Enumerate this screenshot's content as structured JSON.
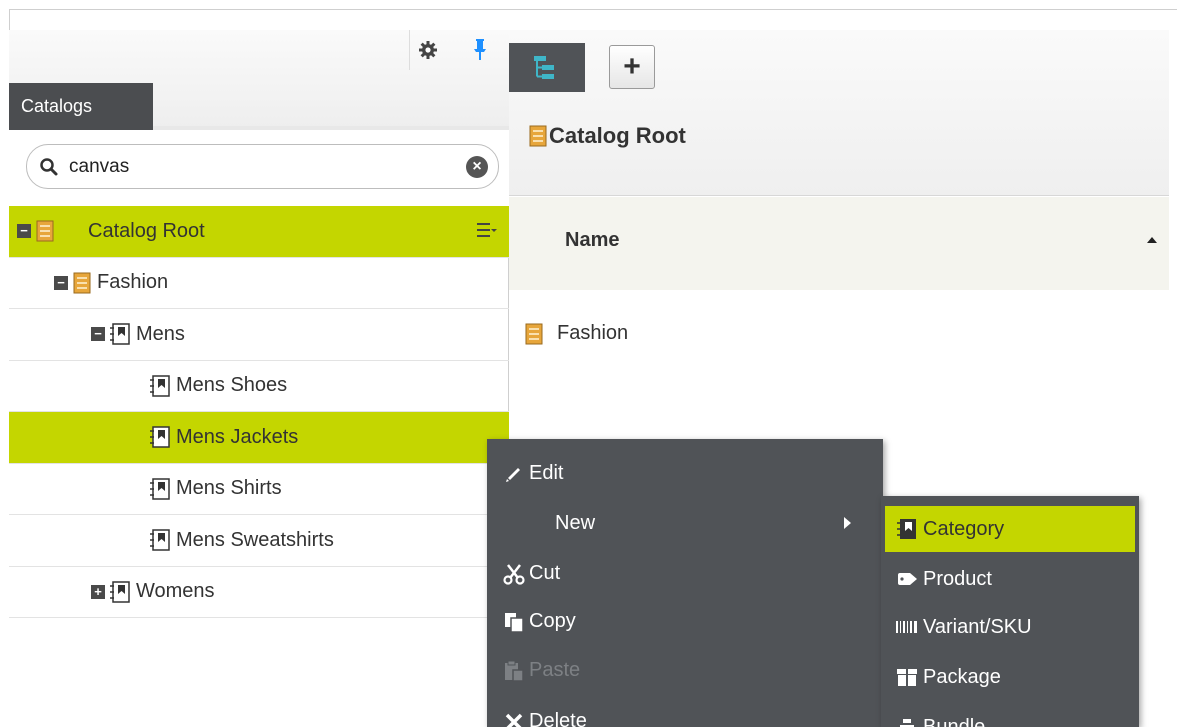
{
  "left_panel": {
    "tab_label": "Catalogs",
    "search": {
      "value": "canvas",
      "clear_glyph": "×"
    },
    "tree": [
      {
        "label": "Catalog Root",
        "level": 0,
        "expander": "−",
        "icon": "catalog-icon",
        "selected": true
      },
      {
        "label": "Fashion",
        "level": 1,
        "expander": "−",
        "icon": "catalog-icon",
        "selected": false
      },
      {
        "label": "Mens",
        "level": 2,
        "expander": "−",
        "icon": "category-icon",
        "selected": false
      },
      {
        "label": "Mens Shoes",
        "level": 3,
        "expander": "",
        "icon": "category-icon",
        "selected": false
      },
      {
        "label": "Mens Jackets",
        "level": 3,
        "expander": "",
        "icon": "category-icon",
        "selected": true
      },
      {
        "label": "Mens Shirts",
        "level": 3,
        "expander": "",
        "icon": "category-icon",
        "selected": false
      },
      {
        "label": "Mens Sweatshirts",
        "level": 3,
        "expander": "",
        "icon": "category-icon",
        "selected": false
      },
      {
        "label": "Womens",
        "level": 2,
        "expander": "+",
        "icon": "category-icon",
        "selected": false
      }
    ]
  },
  "right_panel": {
    "add_glyph": "+",
    "title": "Catalog Root",
    "grid": {
      "column_name": "Name",
      "rows": [
        "Fashion"
      ]
    }
  },
  "context_menu": {
    "items": [
      {
        "label": "Edit",
        "icon": "pencil-icon",
        "disabled": false
      },
      {
        "label": "New",
        "icon": "",
        "disabled": false,
        "submenu": true
      },
      {
        "label": "Cut",
        "icon": "scissors-icon",
        "disabled": false
      },
      {
        "label": "Copy",
        "icon": "copy-icon",
        "disabled": false
      },
      {
        "label": "Paste",
        "icon": "paste-icon",
        "disabled": true
      },
      {
        "label": "Delete",
        "icon": "x-icon",
        "disabled": false
      }
    ]
  },
  "submenu": {
    "items": [
      {
        "label": "Category",
        "icon": "category-icon",
        "highlighted": true
      },
      {
        "label": "Product",
        "icon": "tag-icon",
        "highlighted": false
      },
      {
        "label": "Variant/SKU",
        "icon": "barcode-icon",
        "highlighted": false
      },
      {
        "label": "Package",
        "icon": "package-icon",
        "highlighted": false
      },
      {
        "label": "Bundle",
        "icon": "bundle-icon",
        "highlighted": false
      }
    ]
  },
  "colors": {
    "accent": "#c4d600",
    "menu_bg": "#505357",
    "tab_bg": "#4b4d50",
    "pin": "#1e90ff",
    "tree_icon": "#3fb6c8"
  }
}
